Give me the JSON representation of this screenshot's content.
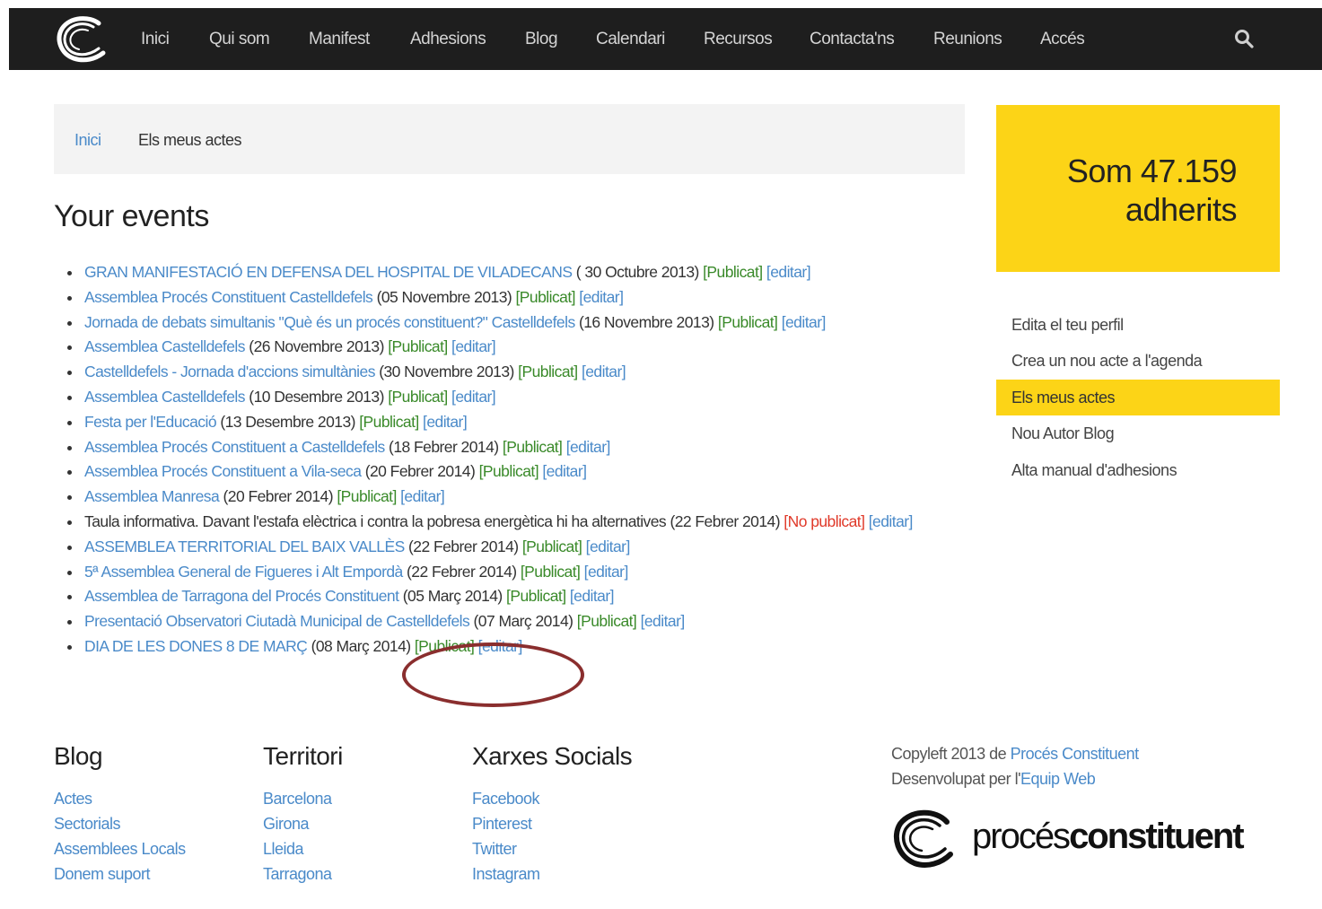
{
  "nav": {
    "items": [
      "Inici",
      "Qui som",
      "Manifest",
      "Adhesions",
      "Blog",
      "Calendari",
      "Recursos",
      "Contacta'ns",
      "Reunions",
      "Accés"
    ]
  },
  "breadcrumb": {
    "home": "Inici",
    "current": "Els meus actes"
  },
  "page_title": "Your events",
  "events": [
    {
      "title": "GRAN MANIFESTACIÓ EN DEFENSA DEL HOSPITAL DE VILADECANS",
      "date": "( 30 Octubre 2013)",
      "status": "[Publicat]",
      "published": true,
      "edit": "[editar]"
    },
    {
      "title": "Assemblea Procés Constituent Castelldefels",
      "date": "(05 Novembre 2013)",
      "status": "[Publicat]",
      "published": true,
      "edit": "[editar]"
    },
    {
      "title": "Jornada de debats simultanis \"Què és un procés constituent?\" Castelldefels",
      "date": "(16 Novembre 2013)",
      "status": "[Publicat]",
      "published": true,
      "edit": "[editar]"
    },
    {
      "title": "Assemblea Castelldefels",
      "date": "(26 Novembre 2013)",
      "status": "[Publicat]",
      "published": true,
      "edit": "[editar]"
    },
    {
      "title": "Castelldefels - Jornada d'accions simultànies",
      "date": "(30 Novembre 2013)",
      "status": "[Publicat]",
      "published": true,
      "edit": "[editar]"
    },
    {
      "title": "Assemblea Castelldefels",
      "date": "(10 Desembre 2013)",
      "status": "[Publicat]",
      "published": true,
      "edit": "[editar]"
    },
    {
      "title": "Festa per l'Educació",
      "date": "(13 Desembre 2013)",
      "status": "[Publicat]",
      "published": true,
      "edit": "[editar]"
    },
    {
      "title": "Assemblea Procés Constituent a Castelldefels",
      "date": "(18 Febrer 2014)",
      "status": "[Publicat]",
      "published": true,
      "edit": "[editar]"
    },
    {
      "title": "Assemblea Procés Constituent a Vila-seca",
      "date": "(20 Febrer 2014)",
      "status": "[Publicat]",
      "published": true,
      "edit": "[editar]"
    },
    {
      "title": "Assemblea Manresa",
      "date": "(20 Febrer 2014)",
      "status": "[Publicat]",
      "published": true,
      "edit": "[editar]"
    },
    {
      "title": "Taula informativa. Davant l'estafa elèctrica i contra la pobresa energètica hi ha alternatives",
      "date": "(22 Febrer 2014)",
      "status": "[No publicat]",
      "published": false,
      "edit": "[editar]"
    },
    {
      "title": "ASSEMBLEA TERRITORIAL DEL BAIX VALLÈS",
      "date": "(22 Febrer 2014)",
      "status": "[Publicat]",
      "published": true,
      "edit": "[editar]"
    },
    {
      "title": "5ª Assemblea General de Figueres i Alt Empordà",
      "date": "(22 Febrer 2014)",
      "status": "[Publicat]",
      "published": true,
      "edit": "[editar]"
    },
    {
      "title": "Assemblea de Tarragona del Procés Constituent",
      "date": "(05 Març 2014)",
      "status": "[Publicat]",
      "published": true,
      "edit": "[editar]"
    },
    {
      "title": "Presentació Observatori Ciutadà Municipal de Castelldefels",
      "date": "(07 Març 2014)",
      "status": "[Publicat]",
      "published": true,
      "edit": "[editar]"
    },
    {
      "title": "DIA DE LES DONES 8 DE MARÇ",
      "date": "(08 Març 2014)",
      "status": "[Publicat]",
      "published": true,
      "edit": "[editar]"
    }
  ],
  "counter": {
    "line1": "Som 47.159",
    "line2": "adherits"
  },
  "sidebar": {
    "items": [
      {
        "label": "Edita el teu perfil",
        "active": false
      },
      {
        "label": "Crea un nou acte a l'agenda",
        "active": false
      },
      {
        "label": "Els meus actes",
        "active": true
      },
      {
        "label": "Nou Autor Blog",
        "active": false
      },
      {
        "label": "Alta manual d'adhesions",
        "active": false
      }
    ]
  },
  "footer": {
    "columns": [
      {
        "title": "Blog",
        "links": [
          "Actes",
          "Sectorials",
          "Assemblees Locals",
          "Donem suport"
        ]
      },
      {
        "title": "Territori",
        "links": [
          "Barcelona",
          "Girona",
          "Lleida",
          "Tarragona"
        ]
      },
      {
        "title": "Xarxes Socials",
        "links": [
          "Facebook",
          "Pinterest",
          "Twitter",
          "Instagram"
        ]
      }
    ],
    "copyleft_prefix": "Copyleft 2013 de ",
    "copyleft_link": "Procés Constituent",
    "developed_prefix": "Desenvolupat per l'",
    "developed_link": "Equip Web",
    "logo_text_light": "procés",
    "logo_text_bold": "constituent"
  },
  "colors": {
    "accent": "#fcd417",
    "link": "#4a8ac9",
    "published": "#3a8a2a",
    "unpublished": "#e03a2a",
    "annotation": "#8a2e2e",
    "navbar": "#1e1e1e"
  },
  "icons": {
    "logo": "c-swirl-logo",
    "search": "search-icon"
  }
}
